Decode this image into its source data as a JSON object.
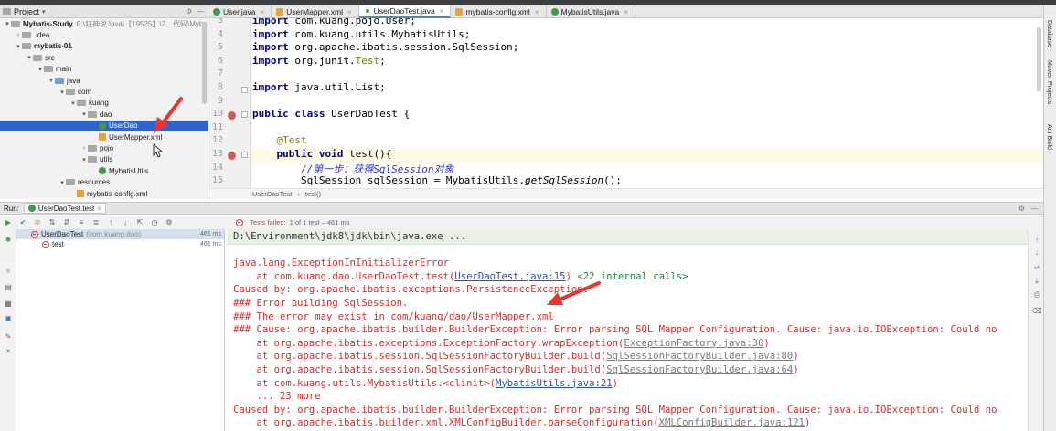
{
  "project": {
    "title": "Project",
    "tree": [
      {
        "label": "Mybatis-Study",
        "note": "F:\\狂神说Java\\【19525】\\2、代码\\Myba",
        "arrow": "▾",
        "icon": "grey"
      },
      {
        "label": ".idea",
        "arrow": "›",
        "icon": "grey"
      },
      {
        "label": "mybatis-01",
        "arrow": "▾",
        "icon": "grey"
      },
      {
        "label": "src",
        "arrow": "▾",
        "icon": "grey"
      },
      {
        "label": "main",
        "arrow": "▾",
        "icon": "grey"
      },
      {
        "label": "java",
        "arrow": "▾",
        "icon": "blue"
      },
      {
        "label": "com",
        "arrow": "▾",
        "icon": "grey"
      },
      {
        "label": "kuang",
        "arrow": "▾",
        "icon": "grey"
      },
      {
        "label": "dao",
        "arrow": "▾",
        "icon": "grey"
      },
      {
        "label": "UserDao",
        "arrow": "",
        "icon": "class",
        "selected": true
      },
      {
        "label": "UserMapper.xml",
        "arrow": "",
        "icon": "xml"
      },
      {
        "label": "pojo",
        "arrow": "›",
        "icon": "grey"
      },
      {
        "label": "utils",
        "arrow": "▾",
        "icon": "grey"
      },
      {
        "label": "MybatisUtils",
        "arrow": "",
        "icon": "class"
      },
      {
        "label": "resources",
        "arrow": "▾",
        "icon": "grey"
      },
      {
        "label": "mybatis-config.xml",
        "arrow": "",
        "icon": "xml"
      }
    ]
  },
  "editor": {
    "tabs": [
      {
        "label": "User.java",
        "icon": "c",
        "active": false
      },
      {
        "label": "UserMapper.xml",
        "icon": "x",
        "active": false
      },
      {
        "label": "UserDaoTest.java",
        "icon": "t",
        "active": true
      },
      {
        "label": "mybatis-config.xml",
        "icon": "x",
        "active": false
      },
      {
        "label": "MybatisUtils.java",
        "icon": "c",
        "active": false
      }
    ],
    "lines": [
      {
        "num": "3",
        "parts": [
          {
            "t": "import ",
            "c": "kw"
          },
          {
            "t": "com.kuang.pojo.User;",
            "c": ""
          }
        ]
      },
      {
        "num": "4",
        "parts": [
          {
            "t": "import ",
            "c": "kw"
          },
          {
            "t": "com.kuang.utils.MybatisUtils;",
            "c": ""
          }
        ]
      },
      {
        "num": "5",
        "parts": [
          {
            "t": "import ",
            "c": "kw"
          },
          {
            "t": "org.apache.ibatis.session.SqlSession;",
            "c": ""
          }
        ]
      },
      {
        "num": "6",
        "parts": [
          {
            "t": "import ",
            "c": "kw"
          },
          {
            "t": "org.junit.",
            "c": ""
          },
          {
            "t": "Test",
            "c": "ann"
          },
          {
            "t": ";",
            "c": ""
          }
        ]
      },
      {
        "num": "7",
        "parts": []
      },
      {
        "num": "8",
        "parts": [
          {
            "t": "import ",
            "c": "kw"
          },
          {
            "t": "java.util.List;",
            "c": ""
          }
        ]
      },
      {
        "num": "9",
        "parts": []
      },
      {
        "num": "10",
        "parts": [
          {
            "t": "public class ",
            "c": "kw"
          },
          {
            "t": "UserDaoTest {",
            "c": ""
          }
        ]
      },
      {
        "num": "11",
        "parts": []
      },
      {
        "num": "12",
        "parts": [
          {
            "t": "    ",
            "c": ""
          },
          {
            "t": "@Test",
            "c": "ann"
          }
        ]
      },
      {
        "num": "13",
        "parts": [
          {
            "t": "    ",
            "c": ""
          },
          {
            "t": "public void ",
            "c": "kw"
          },
          {
            "t": "test(){",
            "c": ""
          }
        ]
      },
      {
        "num": "14",
        "parts": [
          {
            "t": "        ",
            "c": ""
          },
          {
            "t": "//第一步：获得SqlSession对象",
            "c": "cmt"
          }
        ]
      },
      {
        "num": "15",
        "parts": [
          {
            "t": "        SqlSession sqlSession = MybatisUtils.",
            "c": ""
          },
          {
            "t": "getSqlSession",
            "c": "it"
          },
          {
            "t": "();",
            "c": ""
          }
        ]
      }
    ],
    "breadcrumb": [
      "UserDaoTest",
      "test()"
    ]
  },
  "run": {
    "label": "Run:",
    "tab": "UserDaoTest.test",
    "status": "Tests failed:",
    "status_detail": "1 of 1 test – 461 ms",
    "tests": [
      {
        "name": "UserDaoTest",
        "pkg": "(com.kuang.dao)",
        "time": "461 ms"
      },
      {
        "name": "test",
        "pkg": "",
        "time": "461 ms"
      }
    ],
    "console": [
      [
        {
          "t": "D:\\Environment\\jdk8\\jdk\\bin\\java.exe ...",
          "c": "cmd"
        }
      ],
      [],
      [
        {
          "t": "java.lang.ExceptionInInitializerError",
          "c": ""
        }
      ],
      [
        {
          "t": "    at com.kuang.dao.UserDaoTest.test(",
          "c": ""
        },
        {
          "t": "UserDaoTest.java:15",
          "c": "link"
        },
        {
          "t": ") ",
          "c": ""
        },
        {
          "t": "<22 internal calls>",
          "c": "grn"
        }
      ],
      [
        {
          "t": "Caused by: org.apache.ibatis.exceptions.PersistenceException:",
          "c": ""
        }
      ],
      [
        {
          "t": "### Error building SqlSession.",
          "c": ""
        }
      ],
      [
        {
          "t": "### The error may exist in com/kuang/dao/UserMapper.xml",
          "c": ""
        }
      ],
      [
        {
          "t": "### Cause: org.apache.ibatis.builder.BuilderException: Error parsing SQL Mapper Configuration. Cause: java.io.IOException: Could no",
          "c": ""
        }
      ],
      [
        {
          "t": "    at org.apache.ibatis.exceptions.ExceptionFactory.wrapException(",
          "c": ""
        },
        {
          "t": "ExceptionFactory.java:30",
          "c": "glink"
        },
        {
          "t": ")",
          "c": ""
        }
      ],
      [
        {
          "t": "    at org.apache.ibatis.session.SqlSessionFactoryBuilder.build(",
          "c": ""
        },
        {
          "t": "SqlSessionFactoryBuilder.java:80",
          "c": "glink"
        },
        {
          "t": ")",
          "c": ""
        }
      ],
      [
        {
          "t": "    at org.apache.ibatis.session.SqlSessionFactoryBuilder.build(",
          "c": ""
        },
        {
          "t": "SqlSessionFactoryBuilder.java:64",
          "c": "glink"
        },
        {
          "t": ")",
          "c": ""
        }
      ],
      [
        {
          "t": "    at com.kuang.utils.MybatisUtils.<clinit>(",
          "c": ""
        },
        {
          "t": "MybatisUtils.java:21",
          "c": "link"
        },
        {
          "t": ")",
          "c": ""
        }
      ],
      [
        {
          "t": "    ... 23 more",
          "c": ""
        }
      ],
      [
        {
          "t": "Caused by: org.apache.ibatis.builder.BuilderException: Error parsing SQL Mapper Configuration. Cause: java.io.IOException: Could no",
          "c": ""
        }
      ],
      [
        {
          "t": "    at org.apache.ibatis.builder.xml.XMLConfigBuilder.parseConfiguration(",
          "c": ""
        },
        {
          "t": "XMLConfigBuilder.java:121",
          "c": "glink"
        },
        {
          "t": ")",
          "c": ""
        }
      ]
    ]
  },
  "right_strip": [
    "Database",
    "Maven Projects",
    "Ant Build"
  ],
  "colors": {
    "accent": "#2f65ca",
    "error": "#d32c2c",
    "link": "#2a4fb7",
    "annotation_arrow": "#e8362c"
  }
}
